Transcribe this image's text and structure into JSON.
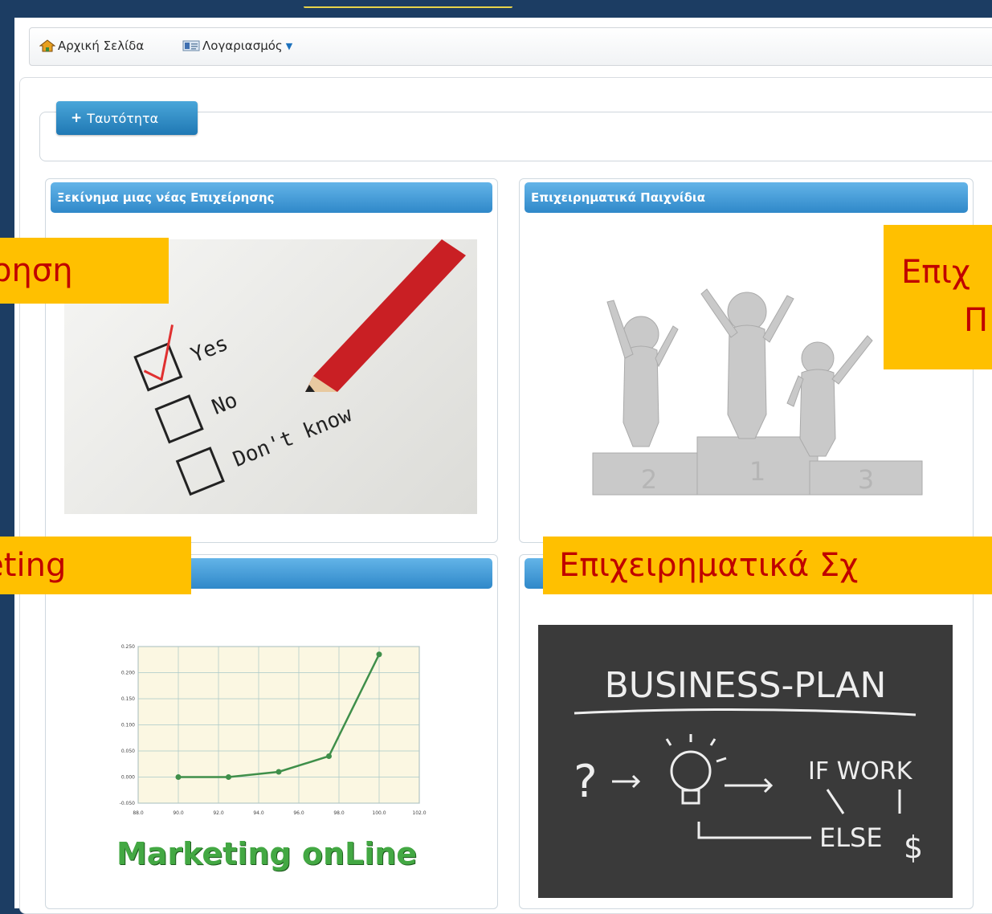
{
  "navbar": {
    "home_label": "Αρχική Σελίδα",
    "account_label": "Λογαριασμός"
  },
  "identity_button": {
    "label": "Ταυτότητα"
  },
  "cards": [
    {
      "title": "Ξεκίνημα μιας νέας Επιχείρησης"
    },
    {
      "title": "Επιχειρηματικά Παιχνίδια"
    },
    {
      "title": ""
    },
    {
      "title": ""
    }
  ],
  "images": {
    "checklist": {
      "options": [
        "Yes",
        "No",
        "Don't know"
      ]
    },
    "podium": {
      "places": [
        "2",
        "1",
        "3"
      ]
    },
    "marketing": {
      "caption": "Marketing onLine"
    },
    "business_plan": {
      "title": "BUSINESS-PLAN",
      "if_text": "IF WORK",
      "else_text": "ELSE",
      "dollar": "$"
    }
  },
  "callouts": {
    "c1": "είρηση",
    "c2_line1": "Επιχ",
    "c2_line2": "Π",
    "c3": "rketing",
    "c4": "Επιχειρηματικά Σχ"
  },
  "chart_data": {
    "type": "line",
    "x": [
      90.0,
      92.5,
      95.0,
      97.5,
      100.0
    ],
    "series": [
      {
        "values": [
          0.0,
          0.0,
          0.01,
          0.04,
          0.235
        ]
      }
    ],
    "xticks": [
      "88.0",
      "90.0",
      "92.0",
      "94.0",
      "96.0",
      "98.0",
      "100.0",
      "102.0"
    ],
    "yticks": [
      "0.250",
      "0.200",
      "0.150",
      "0.100",
      "0.050",
      "0.000",
      "-0.050"
    ],
    "xlim": [
      88,
      102
    ],
    "ylim": [
      -0.05,
      0.25
    ],
    "grid": true,
    "color": "#3f8f4a"
  },
  "colors": {
    "callout_bg": "#ffc000",
    "callout_text": "#c00000",
    "header_blue": "#2f88c9",
    "marketing_green": "#43a843"
  }
}
